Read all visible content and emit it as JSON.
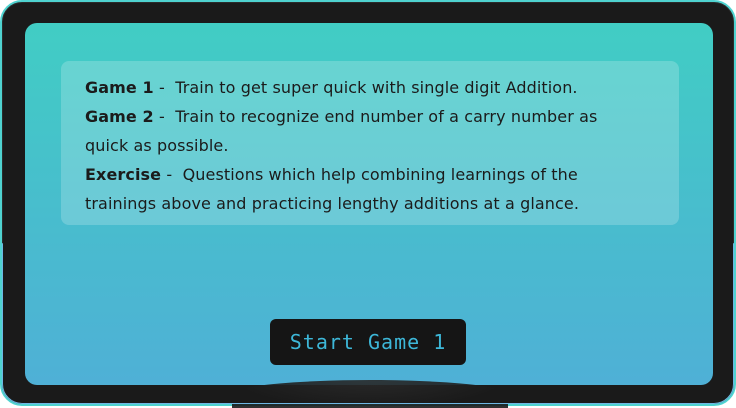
{
  "info": {
    "game1": {
      "label": "Game 1",
      "separator": " -  ",
      "text": "Train to get super quick with single digit Addition."
    },
    "game2": {
      "label": "Game 2",
      "separator": " -  ",
      "text_line1": "Train to recognize end number of a carry number as",
      "text_line2": "quick as possible."
    },
    "exercise": {
      "label": "Exercise",
      "separator": " -  ",
      "text_line1": "Questions which help combining learnings of the",
      "text_line2": "trainings above and practicing lengthy additions at a glance."
    }
  },
  "start_button": {
    "label": "Start Game 1"
  },
  "colors": {
    "frame": "#1a1a1a",
    "screen_top": "#41cdc4",
    "screen_bottom": "#4fb0d6",
    "button_bg": "#151515",
    "button_text": "#3db7d8"
  }
}
